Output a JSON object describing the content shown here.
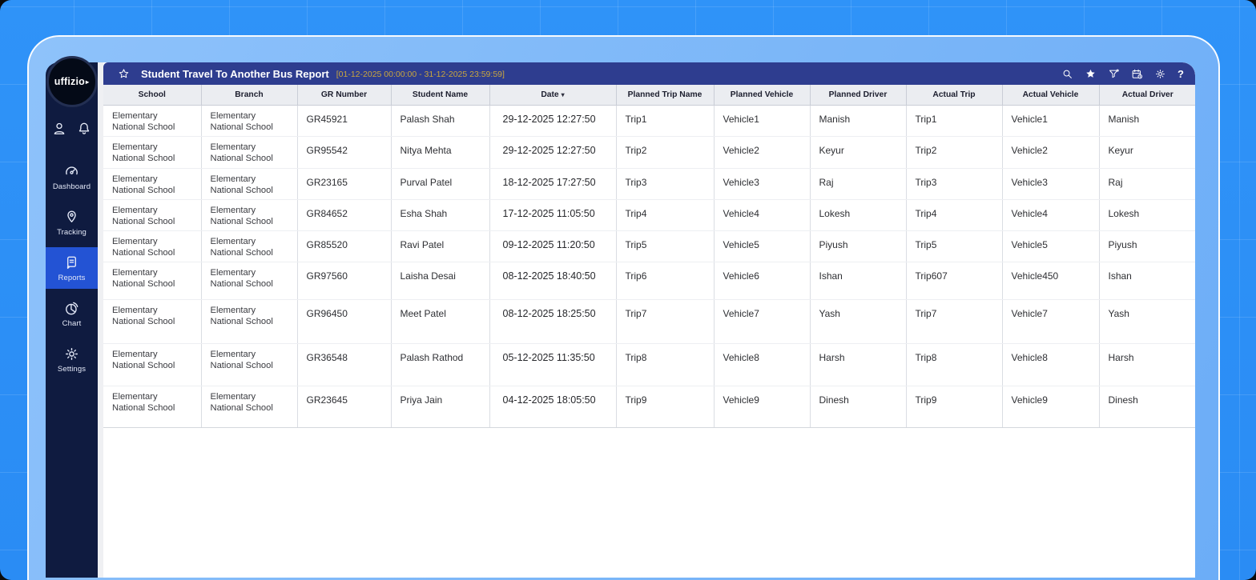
{
  "header": {
    "title": "Student Travel To Another Bus Report",
    "date_range": "[01-12-2025 00:00:00 - 31-12-2025 23:59:59]",
    "favorite_icon": "star-outline-icon",
    "right_icons": [
      {
        "name": "search-icon",
        "icon": "search-icon"
      },
      {
        "name": "favorites-icon",
        "icon": "star-icon"
      },
      {
        "name": "filter-icon",
        "icon": "filter-icon"
      },
      {
        "name": "schedule-report-icon",
        "icon": "calendar-icon"
      },
      {
        "name": "settings-icon",
        "icon": "gear-icon"
      },
      {
        "name": "help-icon",
        "icon": "help-icon"
      }
    ]
  },
  "sidebar": {
    "logo_text": "uffizio",
    "top_icons": [
      {
        "name": "user-icon",
        "icon": "person-icon"
      },
      {
        "name": "notifications-icon",
        "icon": "bell-icon"
      }
    ],
    "items": [
      {
        "id": "dashboard",
        "label": "Dashboard",
        "icon": "dashboard-icon",
        "active": false
      },
      {
        "id": "tracking",
        "label": "Tracking",
        "icon": "tracking-icon",
        "active": false
      },
      {
        "id": "reports",
        "label": "Reports",
        "icon": "reports-icon",
        "active": true
      },
      {
        "id": "chart",
        "label": "Chart",
        "icon": "chart-icon",
        "active": false
      },
      {
        "id": "settings",
        "label": "Settings",
        "icon": "settings-icon",
        "active": false
      }
    ]
  },
  "table": {
    "columns": [
      {
        "key": "school",
        "label": "School"
      },
      {
        "key": "branch",
        "label": "Branch"
      },
      {
        "key": "gr-number",
        "label": "GR Number"
      },
      {
        "key": "student-name",
        "label": "Student Name"
      },
      {
        "key": "date",
        "label": "Date",
        "sorted": "desc"
      },
      {
        "key": "planned-trip-name",
        "label": "Planned Trip Name"
      },
      {
        "key": "planned-vehicle",
        "label": "Planned Vehicle"
      },
      {
        "key": "planned-driver",
        "label": "Planned Driver"
      },
      {
        "key": "actual-trip",
        "label": "Actual Trip"
      },
      {
        "key": "actual-vehicle",
        "label": "Actual Vehicle"
      },
      {
        "key": "actual-driver",
        "label": "Actual Driver"
      }
    ],
    "rows": [
      [
        "Elementary National School",
        "Elementary National School",
        "GR45921",
        "Palash Shah",
        "29-12-2025 12:27:50",
        "Trip1",
        "Vehicle1",
        "Manish",
        "Trip1",
        "Vehicle1",
        "Manish"
      ],
      [
        "Elementary National School",
        "Elementary National School",
        "GR95542",
        "Nitya Mehta",
        "29-12-2025 12:27:50",
        "Trip2",
        "Vehicle2",
        "Keyur",
        "Trip2",
        "Vehicle2",
        "Keyur"
      ],
      [
        "Elementary National School",
        "Elementary National School",
        "GR23165",
        "Purval Patel",
        "18-12-2025 17:27:50",
        "Trip3",
        "Vehicle3",
        "Raj",
        "Trip3",
        "Vehicle3",
        "Raj"
      ],
      [
        "Elementary National School",
        "Elementary National School",
        "GR84652",
        "Esha Shah",
        "17-12-2025 11:05:50",
        "Trip4",
        "Vehicle4",
        "Lokesh",
        "Trip4",
        "Vehicle4",
        "Lokesh"
      ],
      [
        "Elementary National School",
        "Elementary National School",
        "GR85520",
        "Ravi Patel",
        "09-12-2025 11:20:50",
        "Trip5",
        "Vehicle5",
        "Piyush",
        "Trip5",
        "Vehicle5",
        "Piyush"
      ],
      [
        "Elementary National School",
        "Elementary National School",
        "GR97560",
        "Laisha Desai",
        "08-12-2025 18:40:50",
        "Trip6",
        "Vehicle6",
        "Ishan",
        "Trip607",
        "Vehicle450",
        "Ishan"
      ],
      [
        "Elementary National School",
        "Elementary National School",
        "GR96450",
        "Meet Patel",
        "08-12-2025 18:25:50",
        "Trip7",
        "Vehicle7",
        "Yash",
        "Trip7",
        "Vehicle7",
        "Yash"
      ],
      [
        "Elementary National School",
        "Elementary National School",
        "GR36548",
        "Palash Rathod",
        "05-12-2025 11:35:50",
        "Trip8",
        "Vehicle8",
        "Harsh",
        "Trip8",
        "Vehicle8",
        "Harsh"
      ],
      [
        "Elementary National School",
        "Elementary National School",
        "GR23645",
        "Priya Jain",
        "04-12-2025 18:05:50",
        "Trip9",
        "Vehicle9",
        "Dinesh",
        "Trip9",
        "Vehicle9",
        "Dinesh"
      ]
    ]
  },
  "colors": {
    "background_blue": "#2b8ef6",
    "frame_blue": "#74b3f8",
    "topbar_blue": "#2e3d8f",
    "sidebar_navy": "#0f1b40",
    "active_item_blue": "#2353d4",
    "date_range_gold": "#c9a63e",
    "table_header_gray": "#ebedf1"
  }
}
